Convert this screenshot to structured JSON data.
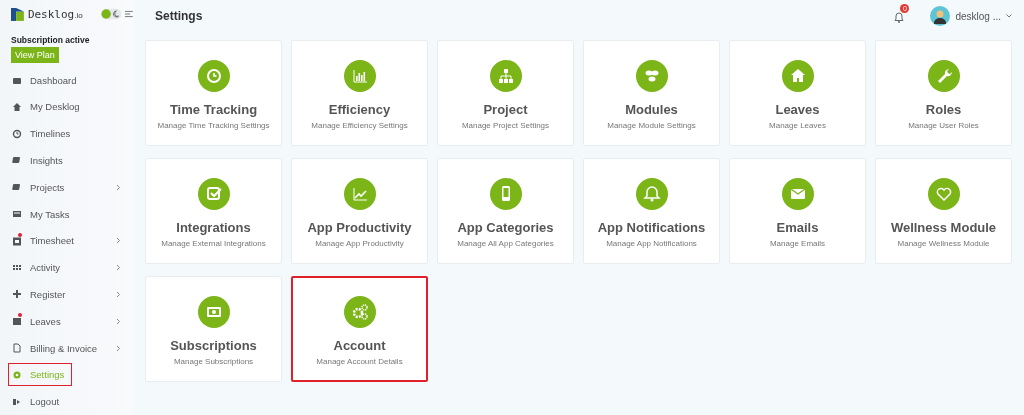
{
  "brand": {
    "name": "Desklog",
    "suffix": ".io"
  },
  "subscription": {
    "status": "Subscription active",
    "button": "View Plan"
  },
  "sidebar": {
    "items": [
      {
        "label": "Dashboard",
        "selected": false,
        "chevron": false,
        "dot": false,
        "highlighted": false
      },
      {
        "label": "My Desklog",
        "selected": false,
        "chevron": false,
        "dot": false,
        "highlighted": false
      },
      {
        "label": "Timelines",
        "selected": false,
        "chevron": false,
        "dot": false,
        "highlighted": false
      },
      {
        "label": "Insights",
        "selected": false,
        "chevron": false,
        "dot": false,
        "highlighted": false
      },
      {
        "label": "Projects",
        "selected": false,
        "chevron": true,
        "dot": false,
        "highlighted": false
      },
      {
        "label": "My Tasks",
        "selected": false,
        "chevron": false,
        "dot": false,
        "highlighted": false
      },
      {
        "label": "Timesheet",
        "selected": false,
        "chevron": true,
        "dot": true,
        "highlighted": false
      },
      {
        "label": "Activity",
        "selected": false,
        "chevron": true,
        "dot": false,
        "highlighted": false
      },
      {
        "label": "Register",
        "selected": false,
        "chevron": true,
        "dot": false,
        "highlighted": false
      },
      {
        "label": "Leaves",
        "selected": false,
        "chevron": true,
        "dot": true,
        "highlighted": false
      },
      {
        "label": "Billing & Invoice",
        "selected": false,
        "chevron": true,
        "dot": false,
        "highlighted": false
      },
      {
        "label": "Settings",
        "selected": true,
        "chevron": false,
        "dot": false,
        "highlighted": true
      },
      {
        "label": "Logout",
        "selected": false,
        "chevron": false,
        "dot": false,
        "highlighted": false
      }
    ]
  },
  "header": {
    "title": "Settings",
    "notifications": "0",
    "user": "desklog ..."
  },
  "cards": [
    {
      "title": "Time Tracking",
      "description": "Manage Time Tracking Settings",
      "highlighted": false
    },
    {
      "title": "Efficiency",
      "description": "Manage Efficiency Settings",
      "highlighted": false
    },
    {
      "title": "Project",
      "description": "Manage Project Settings",
      "highlighted": false
    },
    {
      "title": "Modules",
      "description": "Manage Module Settings",
      "highlighted": false
    },
    {
      "title": "Leaves",
      "description": "Manage Leaves",
      "highlighted": false
    },
    {
      "title": "Roles",
      "description": "Manage User Roles",
      "highlighted": false
    },
    {
      "title": "Integrations",
      "description": "Manage External Integrations",
      "highlighted": false
    },
    {
      "title": "App Productivity",
      "description": "Manage App Productivity",
      "highlighted": false
    },
    {
      "title": "App Categories",
      "description": "Manage All App Categories",
      "highlighted": false
    },
    {
      "title": "App Notifications",
      "description": "Manage App Notifications",
      "highlighted": false
    },
    {
      "title": "Emails",
      "description": "Manage Emails",
      "highlighted": false
    },
    {
      "title": "Wellness Module",
      "description": "Manage Wellness Module",
      "highlighted": false
    },
    {
      "title": "Subscriptions",
      "description": "Manage Subscriptions",
      "highlighted": false
    },
    {
      "title": "Account",
      "description": "Manage Account Details",
      "highlighted": true
    }
  ]
}
